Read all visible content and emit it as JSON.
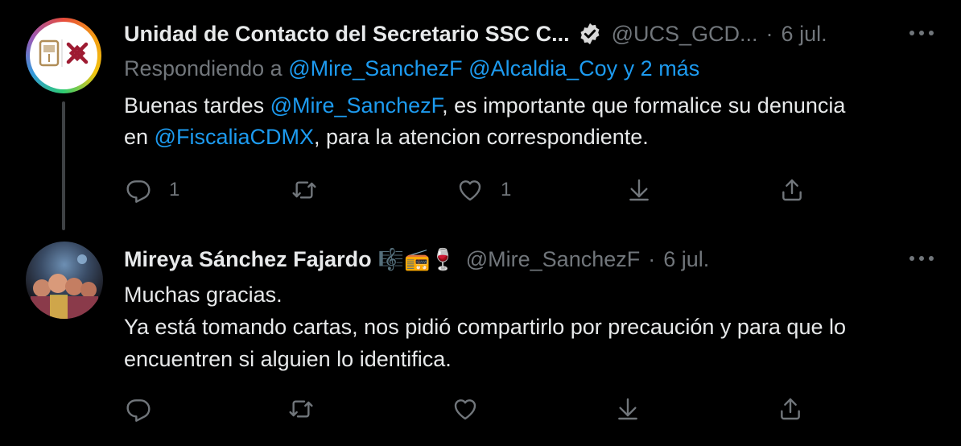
{
  "tweets": [
    {
      "author_name": "Unidad de Contacto del Secretario SSC C...",
      "verified": true,
      "handle": "@UCS_GCD...",
      "date": "6 jul.",
      "replying_prefix": "Respondiendo a",
      "replying_mentions": "@Mire_SanchezF @Alcaldia_Coy y 2 más",
      "text_part1": "Buenas tardes ",
      "text_mention1": "@Mire_SanchezF",
      "text_part2": ", es importante que formalice su denuncia",
      "text_part3": "en ",
      "text_mention2": "@FiscaliaCDMX",
      "text_part4": ", para la atencion correspondiente.",
      "reply_count": "1",
      "retweet_count": "",
      "like_count": "1"
    },
    {
      "author_name": "Mireya Sánchez Fajardo",
      "name_emojis": "🎼📻🍷",
      "handle": "@Mire_SanchezF",
      "date": "6 jul.",
      "text_line1": "Muchas gracias.",
      "text_line2": "Ya está tomando cartas, nos pidió compartirlo por precaución y para que lo",
      "text_line3": "encuentren si alguien lo identifica.",
      "reply_count": "",
      "retweet_count": "",
      "like_count": ""
    }
  ],
  "colors": {
    "background": "#000000",
    "text": "#e7e9ea",
    "secondary": "#71767b",
    "accent": "#1d9bf0"
  },
  "icons": [
    "reply-icon",
    "retweet-icon",
    "like-icon",
    "download-icon",
    "share-icon",
    "more-icon",
    "verified-icon"
  ]
}
